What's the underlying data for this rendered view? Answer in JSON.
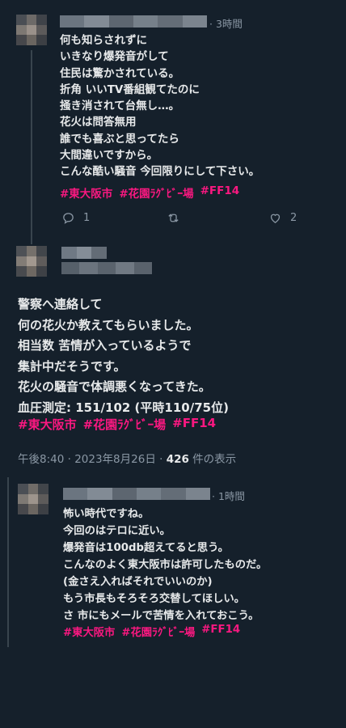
{
  "tweet1": {
    "time": "· 3時間",
    "text": "何も知らされずに\nいきなり爆発音がして\n住民は驚かされている。\n折角 いいTV番組観てたのに\n掻き消されて台無し…。\n花火は問答無用\n誰でも喜ぶと思ってたら\n大間違いですから。\nこんな酷い騒音 今回限りにして下さい。",
    "hashtags": [
      "#東大阪市",
      "#花園ﾗｸﾞﾋﾞｰ場",
      "#FF14"
    ],
    "reply_count": "1",
    "like_count": "2"
  },
  "main_tweet": {
    "text": "警察へ連絡して\n何の花火か教えてもらいました。\n相当数 苦情が入っているようで\n集計中だそうです。\n花火の騒音で体調悪くなってきた。\n血圧測定: 151/102 (平時110/75位)",
    "hashtags": [
      "#東大阪市",
      "#花園ﾗｸﾞﾋﾞｰ場",
      "#FF14"
    ],
    "timestamp": "午後8:40 · 2023年8月26日 · ",
    "views_count": "426",
    "views_label": " 件の表示"
  },
  "tweet3": {
    "time": "· 1時間",
    "text": "怖い時代ですね。\n今回のはテロに近い。\n爆発音は100db超えてると思う。\nこんなのよく東大阪市は許可したものだ。\n(金さえ入ればそれでいいのか)\nもう市長もそろそろ交替してほしい。\nさ 市にもメールで苦情を入れておこう。",
    "hashtags": [
      "#東大阪市",
      "#花園ﾗｸﾞﾋﾞｰ場",
      "#FF14"
    ]
  },
  "colors": {
    "background": "#15202b",
    "hashtag": "#f91880",
    "muted": "#8b98a5",
    "text": "#e7e9ea"
  },
  "icons": [
    "reply-icon",
    "retweet-icon",
    "like-icon"
  ]
}
